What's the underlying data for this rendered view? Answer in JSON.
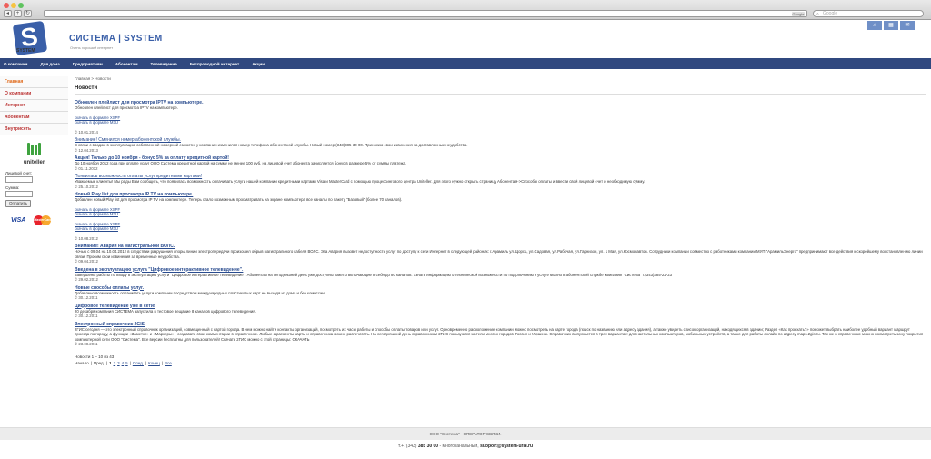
{
  "browser": {
    "nav_back": "◂",
    "nav_fwd": "+",
    "go_label": "Google",
    "search_placeholder": "Google"
  },
  "header": {
    "brand": "СИСТЕМА | SYSTEM",
    "slogan": "Очень хороший интернет",
    "logo_word": "SYSTEM",
    "icons": [
      "home-icon",
      "grid-icon",
      "mail-icon"
    ]
  },
  "topnav": [
    "О компании",
    "Для дома",
    "Предприятиям",
    "Абонентам",
    "Телевидение",
    "Беспроводной интернет",
    "Акции"
  ],
  "sidebar": {
    "items": [
      "Главная",
      "О компании",
      "Интернет",
      "Абонентам",
      "Внутрисеть"
    ],
    "active_index": 0,
    "uniteller": "uniteller",
    "account_label": "Лицевой счет:",
    "amount_label": "Сумма:",
    "pay_button": "Оплатить",
    "visa": "VISA",
    "mastercard": "MasterCard"
  },
  "main": {
    "breadcrumb_home": "Главная",
    "breadcrumb_sep": " > ",
    "breadcrumb_current": "Новости",
    "title": "Новости",
    "news": [
      {
        "title": "Обновлен плейлист для просмотра IPTV на компьютере.",
        "plain": false,
        "text": "Обновлен плейлист для просмотра IPTV на компьютере.",
        "links": [
          "скачать в формате XSPF",
          "скачать в формате M3U"
        ],
        "date": "© 10.01.2014"
      },
      {
        "title": "Внимание! Сменился номер абонентской службы.",
        "plain": true,
        "text": "В связи с вводом в эксплуатацию собственной номерной емкости, у компании изменился номер телефона абонентской службы. Новый номер (343)385-30-00. Приносим свои извинения за доставленные неудобства.",
        "links": [],
        "date": "© 12.04.2013"
      },
      {
        "title": "Акция! Только до 10 ноября - бонус 5% за оплату кредитной картой!",
        "plain": false,
        "text": "До 10 ноября 2012 года при оплате услуг ООО Система кредитной картой на сумму не менее 100 руб. на лицевой счет абонента зачисляется бонус в размере 5% от суммы платежа.",
        "links": [],
        "date": "© 01.11.2012"
      },
      {
        "title": "Появилась возможность оплаты услуг кредитными картами!",
        "plain": true,
        "text": "Уважаемые клиенты! Мы рады Вам сообщить, что появилась возможность оплачивать услуги нашей компании кредитными картами Visa и MasterCard с помощью процессингового центра Uniteller. Для этого нужно открыть страницу Абонентам->Способы оплаты и ввести свой лицевой счет и необходимую сумму.",
        "links": [],
        "date": "© 25.10.2012"
      },
      {
        "title": "Новый Play list для просмотра IP TV на компьютере.",
        "plain": false,
        "text": "Добавлен новый Play list для просмотра IP TV на компьютере. Теперь стало возможным просматривать на экране компьютера все каналы по пакету \"Базовый\" (более 70 каналов).",
        "links": [
          "скачать в формате XSPF",
          "скачать в формате M3U",
          "",
          "скачать в формате XSPF",
          "скачать в формате M3U"
        ],
        "date": "© 10.08.2012"
      },
      {
        "title": "Внимание! Авария на магистральной ВОЛС.",
        "plain": false,
        "text": "Ночью с 09.04 на 10.04.2012 в следствии разрушения опоры линии электропередачи произошел обрыв магистрального кабеля ВОЛС. Эта Авария вызовет недоступность услуг по доступу к сети Интернет в следующей районах: г.Арамиль ул.Щорса, ул.Садовая, ул.Рабочая, ул.Гарнизон, ул. 1 Мая, ул.Космонавтов. Сотрудники компании совместно с работниками компании МУП \"АрамильЭнерго\" предпринимают все действия к скорейшему восстановлению линии связи. Просим свои извинения за временные неудобства.",
        "links": [],
        "date": "© 09.04.2012"
      },
      {
        "title": "Введена в эксплуатацию услуга \"Цифровое интерактивное телевидение\".",
        "plain": false,
        "text": "Завершены работы по вводу в эксплуатацию услуги \"Цифровое интерактивное телевидение\". Абонентам на сегодняшний день уже доступны пакеты включающие в себя до 80 каналов. Узнать информацию о технической возможности по подключению к услуге можно в абонентской службе компании \"Система\" т.(343)385-22-23",
        "links": [],
        "date": "© 29.02.2012"
      },
      {
        "title": "Новые способы оплаты услуг.",
        "plain": false,
        "text": "Добавлено возможность оплачивать услуги компании посредством международных пластиковых карт не выходя из дома и без комиссии.",
        "links": [],
        "date": "© 30.12.2011"
      },
      {
        "title": "Цифровое телевидение уже в сети!",
        "plain": false,
        "text": "20 декабря компания СИСТЕМА запустила в тестовое вещание 8 каналов цифрового телевидения.",
        "links": [],
        "date": "© 30.12.2011"
      },
      {
        "title": "Электронный справочник 2GIS",
        "plain": false,
        "text": "2ГИС сегодня — это электронный справочник организаций, совмещенный с картой города. В нем можно найти контакты организаций, посмотреть их часы работы и способы оплаты товаров или услуг. Одновременно расположение компании можно посмотреть на карте города (поиск по названию или адресу здания), а также увидеть список организаций, находящихся в здании; Раздел «Как проехать?» поможет выбрать наиболее удобный вариант маршрут проезда по городу, а функции «Заметки» и «Маркеры» - создавать свои комментарии в справочнике. Любые фрагменты карты и справочника можно распечатать. На сегодняшний день справочником 2ГИС пользуются жители многих городов России и Украины. Справочник выпускается в трех вариантах: для настольных компьютеров, мобильных устройств, а также для работы онлайн по адресу maps.2gis.ru. Так же в справочнике можно посмотреть зону покрытия компьютерной сети ООО \"Система\". Все версии бесплатны для пользователей! Скачать 2ГИС можно с этой страницы: СКАЧАТЬ",
        "links": [],
        "date": "© 23.08.2011"
      }
    ],
    "pager_info": "Новости 1 – 10 из 43",
    "pager": {
      "start": "Начало",
      "prev": "Пред.",
      "pages": [
        "1",
        "2",
        "3",
        "4",
        "5"
      ],
      "current": "1",
      "next": "След.",
      "last": "Конец",
      "all": "Все"
    }
  },
  "footer": {
    "operator": "ООО \"Система\" - ОПЕРАТОР СВЯЗИ.",
    "phone_prefix": "т.+7(343) ",
    "phone_number": "385 30 00",
    "phone_suffix": " - многоканальный,   ",
    "email": "support@system-ural.ru"
  }
}
